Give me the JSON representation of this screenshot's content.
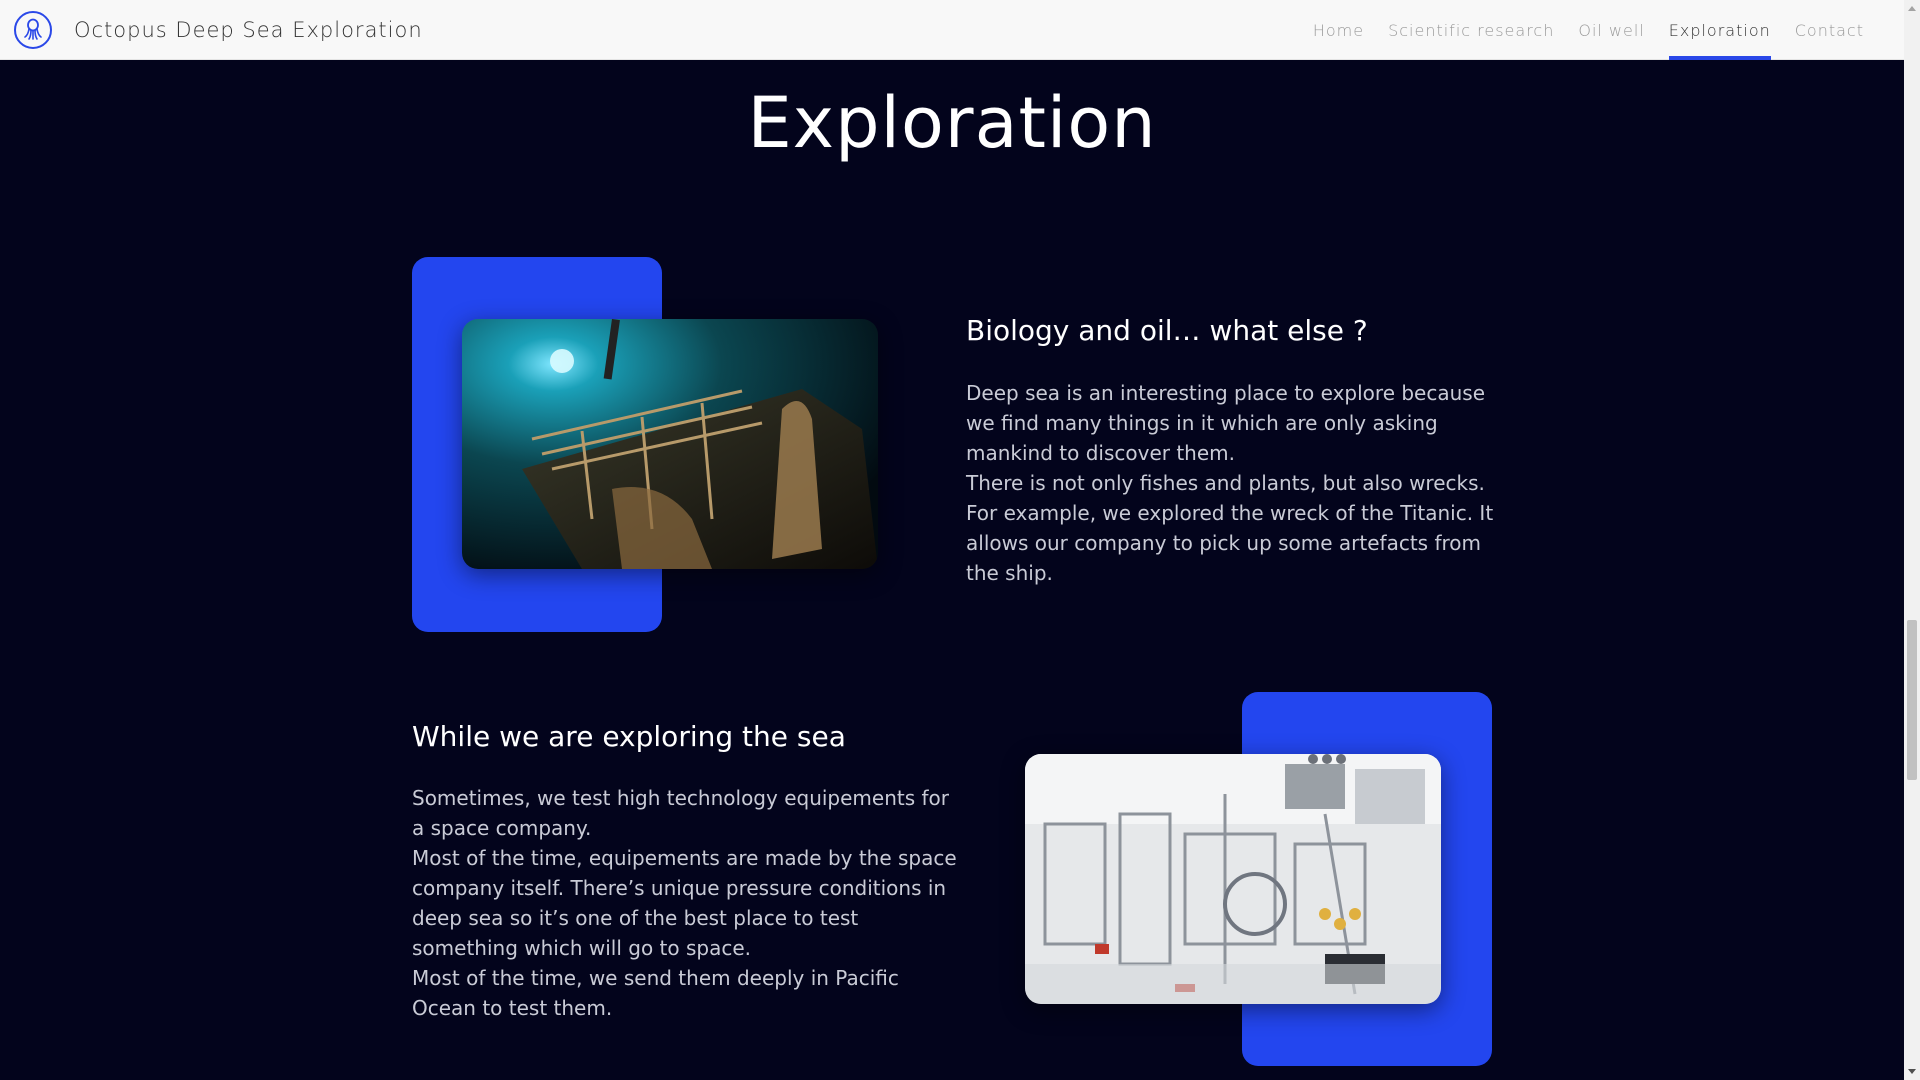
{
  "navbar": {
    "brand_title": "Octopus Deep Sea Exploration",
    "logo_icon": "octopus-icon",
    "links": [
      {
        "label": "Home",
        "active": false
      },
      {
        "label": "Scientific research",
        "active": false
      },
      {
        "label": "Oil well",
        "active": false
      },
      {
        "label": "Exploration",
        "active": true
      },
      {
        "label": "Contact",
        "active": false
      }
    ]
  },
  "page": {
    "heading": "Exploration"
  },
  "sections": [
    {
      "title": "Biology and oil… what else ?",
      "paragraphs": [
        "Deep sea is an interesting place to explore because we find many things in it which are only asking mankind to discover them.",
        "There is not only fishes and plants, but also wrecks. For example, we explored the wreck of the Titanic. It allows our company to pick up some artefacts from the ship."
      ],
      "image_subject": "titanic-wreck-image"
    },
    {
      "title": "While we are exploring the sea",
      "paragraphs": [
        "Sometimes, we test high technology equipements for a space company.",
        "Most of the time, equipements are made by the space company itself. There’s unique pressure conditions in deep sea so it’s one of the best place to test something which will go to space.",
        "Most of the time, we send them deeply in Pacific Ocean to test them."
      ],
      "image_subject": "spacecraft-lab-image"
    }
  ],
  "colors": {
    "background": "#03041c",
    "accent": "#2346ef",
    "navbar": "#f8f8f8"
  }
}
